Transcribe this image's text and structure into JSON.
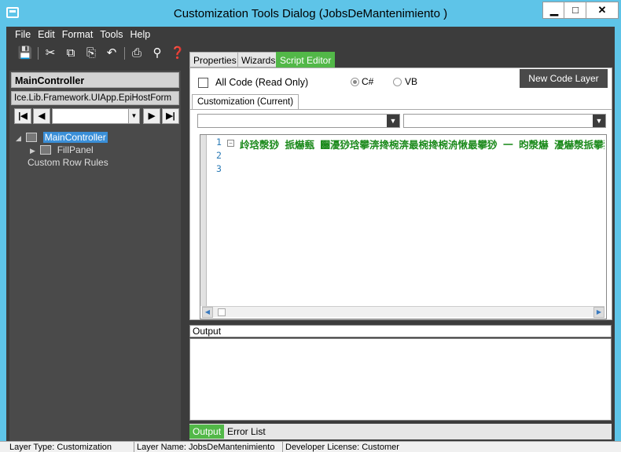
{
  "window": {
    "title": "Customization Tools Dialog  (JobsDeMantenimiento )",
    "minimize": "▁",
    "maximize": "□",
    "close": "✕"
  },
  "menu": [
    "File",
    "Edit",
    "Format",
    "Tools",
    "Help"
  ],
  "toolbar_icons": [
    "save-icon",
    "cut-icon",
    "copy-icon",
    "paste-icon",
    "undo-icon",
    "print-icon",
    "print-preview-icon",
    "help-icon"
  ],
  "left": {
    "control_name": "MainController",
    "control_type": "Ice.Lib.Framework.UIApp.EpiHostForm",
    "nav": {
      "first": "|◀",
      "prev": "◀",
      "next": "▶",
      "last": "▶|",
      "combo_arrow": "▼"
    },
    "tree": {
      "root_toggle": "◢",
      "root": "MainController",
      "child_toggle": "▶",
      "child": "FillPanel",
      "rules": "Custom Row Rules"
    }
  },
  "tabs": [
    "Properties",
    "Wizards",
    "Script Editor"
  ],
  "active_tab": "Script Editor",
  "script": {
    "all_code_label": "All Code (Read Only)",
    "all_code_checked": false,
    "lang_csharp": "C#",
    "lang_vb": "VB",
    "selected_language": "C#",
    "new_code_layer": "New Code Layer",
    "sub_tab": "Customization (Current)",
    "combo_arrow": "▼",
    "line_numbers": [
      "1",
      "2",
      "3"
    ],
    "fold": "−",
    "code_line_1": "㱓琀漀猀 挀爀甀 ਀瀀猀琀攀渀搀椀渀最椀搀椀洀愀最攀猀 ⼀ 昀漀爀 瀀爀漀挀攀猀猀攀猀⼀",
    "scroll_left": "◀",
    "scroll_right": "▶"
  },
  "output": {
    "label": "Output",
    "tabs": [
      "Output",
      "Error List"
    ],
    "active": "Output"
  },
  "status": {
    "layer_type": "Layer Type:  Customization",
    "layer_name": "Layer Name:  JobsDeMantenimiento",
    "license": "Developer License:  Customer"
  },
  "colors": {
    "titlebar": "#5ec4e8",
    "accent_green": "#52b848",
    "code_green": "#1c8a1c",
    "dark_bg": "#3c3c3c"
  }
}
